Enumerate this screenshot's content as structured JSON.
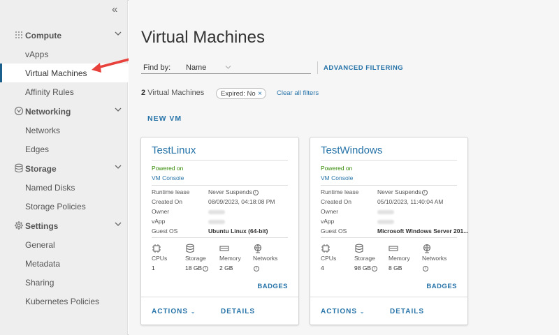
{
  "sidebar": {
    "collapse_glyph": "«",
    "sections": [
      {
        "label": "Compute",
        "icon": "grid-icon",
        "items": [
          "vApps",
          "Virtual Machines",
          "Affinity Rules"
        ]
      },
      {
        "label": "Networking",
        "icon": "network-icon",
        "items": [
          "Networks",
          "Edges"
        ]
      },
      {
        "label": "Storage",
        "icon": "database-icon",
        "items": [
          "Named Disks",
          "Storage Policies"
        ]
      },
      {
        "label": "Settings",
        "icon": "gear-icon",
        "items": [
          "General",
          "Metadata",
          "Sharing",
          "Kubernetes Policies"
        ]
      }
    ],
    "active_item": "Virtual Machines"
  },
  "main": {
    "title": "Virtual Machines",
    "find_by_label": "Find by:",
    "find_by_value": "Name",
    "advanced_filtering": "ADVANCED FILTERING",
    "count_number": "2",
    "count_label": "Virtual Machines",
    "filter_chip": "Expired: No",
    "filter_chip_remove": "×",
    "clear_filters": "Clear all filters",
    "new_vm": "NEW VM"
  },
  "cards": [
    {
      "name": "TestLinux",
      "power_state": "Powered on",
      "console_link": "VM Console",
      "props": [
        {
          "key": "Runtime lease",
          "value": "Never Suspends"
        },
        {
          "key": "Created On",
          "value": "08/09/2023, 04:18:08 PM"
        },
        {
          "key": "Owner",
          "value": ""
        },
        {
          "key": "vApp",
          "value": ""
        },
        {
          "key": "Guest OS",
          "value": "Ubuntu Linux (64-bit)"
        }
      ],
      "resources": [
        {
          "label": "CPUs",
          "value": "1"
        },
        {
          "label": "Storage",
          "value": "18 GB"
        },
        {
          "label": "Memory",
          "value": "2 GB"
        },
        {
          "label": "Networks",
          "value": ""
        }
      ],
      "badges": "BADGES",
      "actions": "ACTIONS",
      "details": "DETAILS"
    },
    {
      "name": "TestWindows",
      "power_state": "Powered on",
      "console_link": "VM Console",
      "props": [
        {
          "key": "Runtime lease",
          "value": "Never Suspends"
        },
        {
          "key": "Created On",
          "value": "05/10/2023, 11:40:04 AM"
        },
        {
          "key": "Owner",
          "value": ""
        },
        {
          "key": "vApp",
          "value": ""
        },
        {
          "key": "Guest OS",
          "value": "Microsoft Windows Server 201..."
        }
      ],
      "resources": [
        {
          "label": "CPUs",
          "value": "4"
        },
        {
          "label": "Storage",
          "value": "98 GB"
        },
        {
          "label": "Memory",
          "value": "8 GB"
        },
        {
          "label": "Networks",
          "value": ""
        }
      ],
      "badges": "BADGES",
      "actions": "ACTIONS",
      "details": "DETAILS"
    }
  ],
  "colors": {
    "accent": "#2673a8",
    "active_border": "#1b5f8c",
    "powered_on": "#318700",
    "annotation_arrow": "#e8413c",
    "sidebar_bg": "#eeeeee",
    "content_bg": "#f6f6f6"
  }
}
